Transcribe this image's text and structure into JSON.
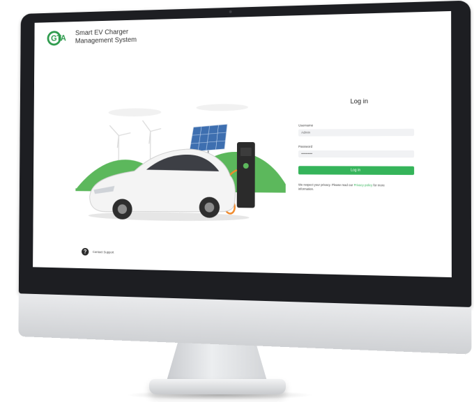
{
  "app": {
    "title_line1": "Smart EV Charger",
    "title_line2": "Management System",
    "logo_text": "GTA"
  },
  "login": {
    "heading": "Log in",
    "username_label": "Username",
    "username_value": "Admin",
    "password_label": "Password",
    "password_value": "••••••••••",
    "button_label": "Log in",
    "privacy_text": "We respect your privacy. Please read our",
    "privacy_link": "Privacy policy",
    "privacy_suffix": "for more information."
  },
  "footer": {
    "support_label": "Contact Support",
    "support_icon_glyph": "?"
  },
  "colors": {
    "accent": "#35b45a",
    "hills": "#5cb85c",
    "bezel": "#1d1e22"
  },
  "icons": {
    "support": "question-circle-icon",
    "logo": "gta-logo-icon"
  }
}
